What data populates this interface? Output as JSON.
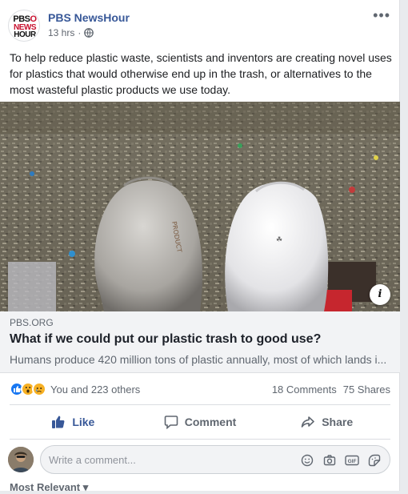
{
  "post": {
    "page_name": "PBS NewsHour",
    "time": "13 hrs",
    "dot": "·",
    "logo": {
      "line1_a": "PBS",
      "line1_b": "O",
      "line2": "NEWS",
      "line3": "HOUR"
    },
    "more_label": "•••",
    "text": "To help reduce plastic waste, scientists and inventors are creating novel uses for plastics that would otherwise end up in the trash, or alternatives to the most wasteful plastic products we use today."
  },
  "link": {
    "domain": "PBS.ORG",
    "title": "What if we could put our plastic trash to good use?",
    "description": "Humans produce 420 million tons of plastic annually, most of which lands i...",
    "info_label": "i"
  },
  "stats": {
    "reaction_text": "You and 223 others",
    "comments": "18 Comments",
    "shares": "75 Shares"
  },
  "actions": {
    "like": "Like",
    "comment": "Comment",
    "share": "Share"
  },
  "composer": {
    "placeholder": "Write a comment..."
  },
  "footer": {
    "sort": "Most Relevant ▾"
  },
  "colors": {
    "brand_blue": "#385898",
    "like_blue": "#1877f2",
    "wow_yellow": "#f7b125"
  }
}
